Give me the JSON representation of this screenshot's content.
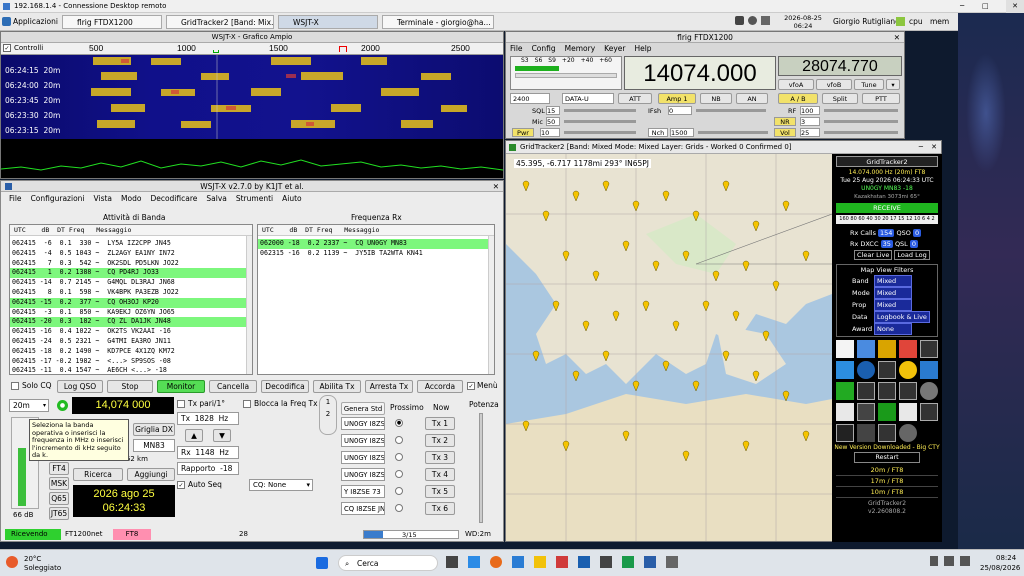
{
  "rdp": {
    "title": "192.168.1.4 - Connessione Desktop remoto"
  },
  "topbar": {
    "apps_label": "Applicazioni",
    "tasks": [
      "flrig FTDX1200",
      "GridTracker2 [Band: Mix...",
      "WSJT-X",
      "Terminale - giorgio@ha..."
    ],
    "datetime": "2026-08-25\n06:24",
    "user": "Giorgio Rutigliano",
    "cpu": "cpu",
    "mem": "mem"
  },
  "waterfall": {
    "title": "WSJT-X - Grafico Ampio",
    "controls_label": "Controlli",
    "scale": [
      "500",
      "1000",
      "1500",
      "2000",
      "2500"
    ],
    "times": [
      "06:24:15",
      "06:24:00",
      "06:23:45",
      "06:23:30",
      "06:23:15"
    ],
    "band": "20m"
  },
  "wsjtx": {
    "title": "WSJT-X   v2.7.0   by K1JT et al.",
    "menu": [
      "File",
      "Configurazioni",
      "Vista",
      "Modo",
      "Decodificare",
      "Salva",
      "Strumenti",
      "Aiuto"
    ],
    "band_activity": "Attività di Banda",
    "rx_freq": "Frequenza Rx",
    "headers": [
      "UTC",
      "dB",
      "DT",
      "Freq",
      "Messaggio"
    ],
    "left_rows": [
      {
        "t": "062415  -6  0.1  330 ~  LY5A IZ2CPP JN45",
        "hl": false
      },
      {
        "t": "062415  -4  0.5 1043 ~  ZL2AGY EA1NY IN72",
        "hl": false
      },
      {
        "t": "062415   7  0.3  542 ~  OK2SDL PD5LKN JO22",
        "hl": false
      },
      {
        "t": "062415   1  0.2 1388 ~  CQ PD4RJ JO33",
        "hl": true
      },
      {
        "t": "062415 -14  0.7 2145 ~  G4MQL DL3RAJ JN68",
        "hl": false
      },
      {
        "t": "062415   8  0.1  598 ~  VK4BPK PA3EZB JO22",
        "hl": false
      },
      {
        "t": "062415 -15  0.2  377 ~  CQ OH3OJ KP20",
        "hl": true
      },
      {
        "t": "062415  -3  0.1  850 ~  KA9EKJ OZ6YN JO65",
        "hl": false
      },
      {
        "t": "062415 -20  0.3  182 ~  CQ ZL DA1JK JN48",
        "hl": true
      },
      {
        "t": "062415 -16  0.4 1022 ~  OK2TS VK2AAI -16",
        "hl": false
      },
      {
        "t": "062415 -24  0.5 2321 ~  G4TMI EA3RO JN11",
        "hl": false
      },
      {
        "t": "062415 -18  0.2 1490 ~  KD7PCE 4X1ZQ KM72",
        "hl": false
      },
      {
        "t": "062415 -17 -0.2 1982 ~  <...> SP9SOS -08",
        "hl": false
      },
      {
        "t": "062415 -11  0.4 1547 ~  AE6CH <...> -18",
        "hl": false
      }
    ],
    "right_rows": [
      {
        "t": "062000 -18  0.2 2337 ~  CQ UN0GY MN83",
        "hl": true
      },
      {
        "t": "062315 -16  0.2 1139 ~  JY5IB TA2WTA KN41",
        "hl": false
      }
    ],
    "buttons": {
      "solo_cq": "Solo CQ",
      "log_qso": "Log QSO",
      "stop": "Stop",
      "monitor": "Monitor",
      "cancella": "Cancella",
      "decodifica": "Decodifica",
      "abilita_tx": "Abilita Tx",
      "arresta_tx": "Arresta Tx",
      "accorda": "Accorda",
      "menu": "Menù"
    },
    "band_select": "20m",
    "freq": "14,074 000",
    "tooltip": "Seleziona la banda operativa o inserisci la frequenza in MHz o inserisci l'incremento di kHz seguito da k.",
    "griglia": "Griglia DX",
    "grid": "MN83",
    "dist": "4962 km",
    "ricerca": "Ricerca",
    "aggiungi": "Aggiungi",
    "modes": [
      "FT4",
      "MSK",
      "Q65",
      "JT65"
    ],
    "date": "2026 ago 25",
    "time": "06:24:33",
    "db": "66 dB",
    "tx_pari": "Tx pari/1°",
    "tx_hz": "Tx  1828  Hz",
    "rx_hz": "Rx  1148  Hz",
    "rapporto": "Rapporto  -18",
    "auto_seq": "Auto Seq",
    "blocca": "Blocca la Freq Tx",
    "cq_none": "CQ: None",
    "prossimo": "Prossimo",
    "now": "Now",
    "potenza": "Potenza",
    "genera": "Genera Std Msgs",
    "tx_msgs": [
      "UN0GY I8ZSE",
      "UN0GY I8ZSE",
      "UN0GY I8ZSE",
      "UN0GY I8ZSE",
      "Y I8ZSE 73",
      "CQ I8ZSE JN70"
    ],
    "tx_buttons": [
      "Tx 1",
      "Tx 2",
      "Tx 3",
      "Tx 4",
      "Tx 5",
      "Tx 6"
    ],
    "status": {
      "receiving": "Ricevendo",
      "station": "FT1200net",
      "mode": "FT8",
      "num": "28",
      "progress": "3/15",
      "wd": "WD:2m"
    }
  },
  "flrig": {
    "title": "flrig FTDX1200",
    "menu": [
      "File",
      "Config",
      "Memory",
      "Keyer",
      "Help"
    ],
    "vfo_a": "14074.000",
    "vfo_b": "28074.770",
    "bw": "2400",
    "mode": "DATA-U",
    "labels": {
      "sql": "SQL",
      "mic": "Mic",
      "pwr": "Pwr",
      "rf": "RF",
      "nr": "NR",
      "nch": "Nch",
      "vol": "Vol",
      "ifsh": "IFsh",
      "att": "ATT",
      "amp": "Amp 1",
      "nb": "NB",
      "an": "AN",
      "vfoA": "vfoA",
      "vfoB": "vfoB",
      "tune": "Tune",
      "ab": "A / B",
      "split": "Split",
      "ptt": "PTT"
    },
    "values": {
      "sql": "15",
      "mic": "50",
      "pwr": "10",
      "rf": "100",
      "nr": "3",
      "nch": "1500",
      "vol": "25",
      "ifsh": "0"
    },
    "meter": [
      "S3",
      "S6",
      "S9",
      "+20",
      "+40",
      "+60"
    ]
  },
  "gridtracker": {
    "title": "GridTracker2 [Band: Mixed Mode: Mixed Layer: Grids - Worked 0 Confirmed 0]",
    "coords": "45.395, -6.717 1178mi 293° IN65PJ",
    "panel_title": "GridTracker2",
    "freq": "14.074.000 Hz (20m)",
    "mode": "FT8",
    "date": "Tue 25 Aug 2026 06:24:33 UTC",
    "dx": "UN0GY",
    "dxgrid": "MN83 -18",
    "country": "Kazakhstan 3073mi 65°",
    "receive": "RECEIVE",
    "bands": "160 80 60 40 30 20 17 15 12 10 6 4 2",
    "rx_calls": "Rx Calls",
    "rx_calls_n": "154",
    "qso": "QSO",
    "qso_n": "0",
    "rx_dxcc": "Rx DXCC",
    "rx_dxcc_n": "35",
    "qsl": "QSL",
    "qsl_n": "0",
    "clear_live": "Clear Live",
    "load_log": "Load Log",
    "filters_title": "Map View Filters",
    "filters": [
      {
        "k": "Band",
        "v": "Mixed"
      },
      {
        "k": "Mode",
        "v": "Mixed"
      },
      {
        "k": "Prop",
        "v": "Mixed"
      },
      {
        "k": "Data",
        "v": "Logbook & Live"
      },
      {
        "k": "Award",
        "v": "None"
      }
    ],
    "new_version": "New Version Downloaded - Big CTY",
    "restart": "Restart",
    "bandlines": [
      "20m / FT8",
      "17m / FT8",
      "10m / FT8"
    ],
    "footer": "GridTracker2",
    "version": "v2.260808.2"
  },
  "taskbar": {
    "temp": "20°C",
    "weather": "Soleggiato",
    "search": "Cerca",
    "time": "08:24",
    "date": "25/08/2026"
  },
  "colors": {
    "highlight": "#7df77d",
    "monitor": "#55dd55",
    "freq_bg": "#000000",
    "freq_fg": "#ffff40",
    "gt_bg": "#000000"
  }
}
